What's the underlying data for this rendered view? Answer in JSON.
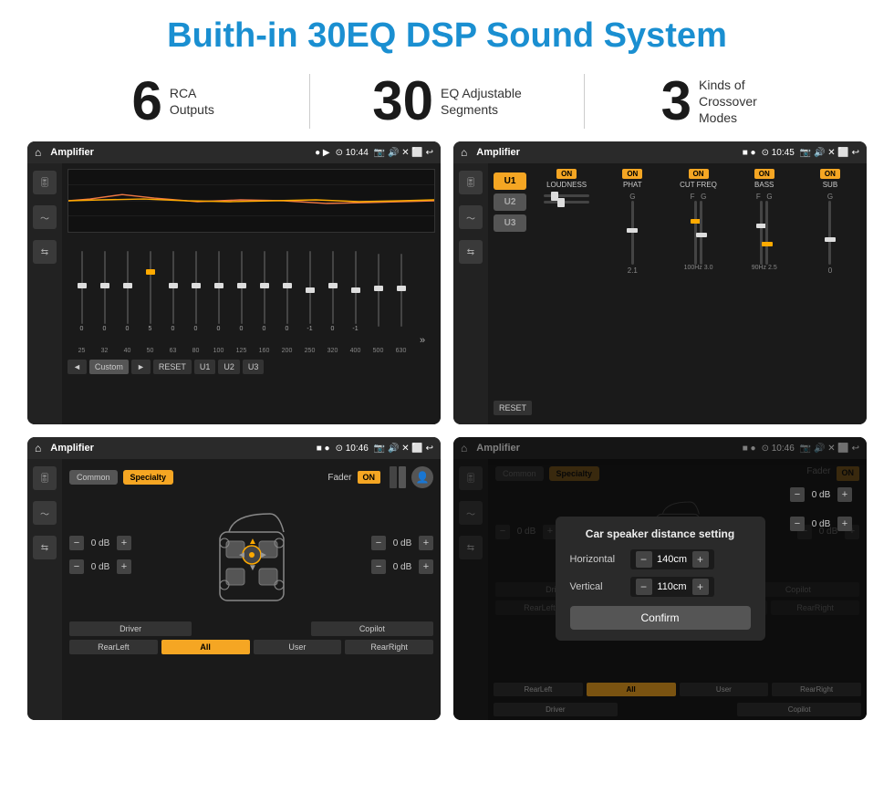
{
  "header": {
    "title": "Buith-in 30EQ DSP Sound System"
  },
  "stats": [
    {
      "number": "6",
      "label": "RCA\nOutputs"
    },
    {
      "number": "30",
      "label": "EQ Adjustable\nSegments"
    },
    {
      "number": "3",
      "label": "Kinds of\nCrossover Modes"
    }
  ],
  "screens": [
    {
      "id": "eq-screen",
      "statusBar": {
        "title": "Amplifier",
        "time": "10:44"
      }
    },
    {
      "id": "crossover-screen",
      "statusBar": {
        "title": "Amplifier",
        "time": "10:45"
      }
    },
    {
      "id": "fader-screen",
      "statusBar": {
        "title": "Amplifier",
        "time": "10:46"
      }
    },
    {
      "id": "dialog-screen",
      "statusBar": {
        "title": "Amplifier",
        "time": "10:46"
      },
      "dialog": {
        "title": "Car speaker distance setting",
        "horizontal_label": "Horizontal",
        "horizontal_value": "140cm",
        "vertical_label": "Vertical",
        "vertical_value": "110cm",
        "confirm_label": "Confirm"
      }
    }
  ],
  "eq": {
    "freqs": [
      "25",
      "32",
      "40",
      "50",
      "63",
      "80",
      "100",
      "125",
      "160",
      "200",
      "250",
      "320",
      "400",
      "500",
      "630"
    ],
    "values": [
      "0",
      "0",
      "0",
      "5",
      "0",
      "0",
      "0",
      "0",
      "0",
      "0",
      "-1",
      "0",
      "-1",
      "",
      ""
    ],
    "presets": [
      "◄",
      "Custom",
      "►",
      "RESET",
      "U1",
      "U2",
      "U3"
    ]
  },
  "crossover": {
    "u_buttons": [
      "U1",
      "U2",
      "U3"
    ],
    "controls": [
      "LOUDNESS",
      "PHAT",
      "CUT FREQ",
      "BASS",
      "SUB"
    ],
    "reset_label": "RESET"
  },
  "fader": {
    "tabs": [
      "Common",
      "Specialty"
    ],
    "fader_label": "Fader",
    "on_label": "ON",
    "volumes": [
      "0 dB",
      "0 dB",
      "0 dB",
      "0 dB"
    ],
    "buttons": [
      "Driver",
      "",
      "Copilot",
      "RearLeft",
      "All",
      "User",
      "RearRight"
    ]
  },
  "dialog": {
    "title": "Car speaker distance setting",
    "horizontal": "140cm",
    "vertical": "110cm",
    "confirm": "Confirm"
  }
}
